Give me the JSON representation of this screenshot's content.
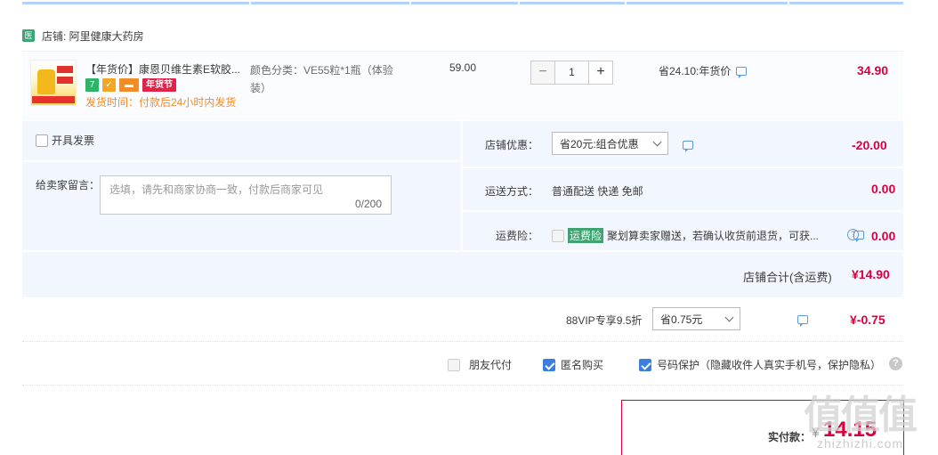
{
  "shop": {
    "icon_text": "医",
    "label": "店铺: 阿里健康大药房"
  },
  "item": {
    "title": "【年货价】康恩贝维生素E软胶...",
    "badge_7": "7",
    "badge_nian": "年货节",
    "ship_time": "发货时间：付款后24小时内发货",
    "attr_line1": "颜色分类：VE55粒*1瓶（体验",
    "attr_line2": "装）",
    "unit_price": "59.00",
    "qty_minus": "−",
    "qty_value": "1",
    "qty_plus": "+",
    "saving": "省24.10:年货价",
    "subtotal": "34.90"
  },
  "options": {
    "invoice_label": "开具发票",
    "message_label": "给卖家留言：",
    "message_placeholder": "选填，请先和商家协商一致，付款后商家可见",
    "message_count": "0/200",
    "shop_discount_label": "店铺优惠：",
    "shop_discount_value": "省20元:组合优惠",
    "shop_discount_amount": "-20.00",
    "shipping_label": "运送方式：",
    "shipping_value": "普通配送 快递 免邮",
    "shipping_amount": "0.00",
    "insurance_label": "运费险：",
    "insurance_tag": "运费险",
    "insurance_text": "聚划算卖家赠送，若确认收货前退货，可获...",
    "insurance_amount": "0.00",
    "shop_total_label": "店铺合计(含运费)",
    "shop_total_value": "¥14.90"
  },
  "vip": {
    "label": "88VIP专享9.5折",
    "select_value": "省0.75元",
    "amount": "¥-0.75"
  },
  "checkout_options": {
    "friend_pay": "朋友代付",
    "anonymous": "匿名购买",
    "phone_protect": "号码保护（隐藏收件人真实手机号，保护隐私）",
    "help": "?"
  },
  "payment": {
    "label": "实付款：",
    "yen": "¥",
    "amount": "14.15"
  },
  "watermark": {
    "text": "值值值",
    "url": "zhizhizhi.com"
  },
  "colors": {
    "accent_red": "#d9003f",
    "panel_blue": "#f2f7ff",
    "check_blue": "#3a7ee0"
  }
}
